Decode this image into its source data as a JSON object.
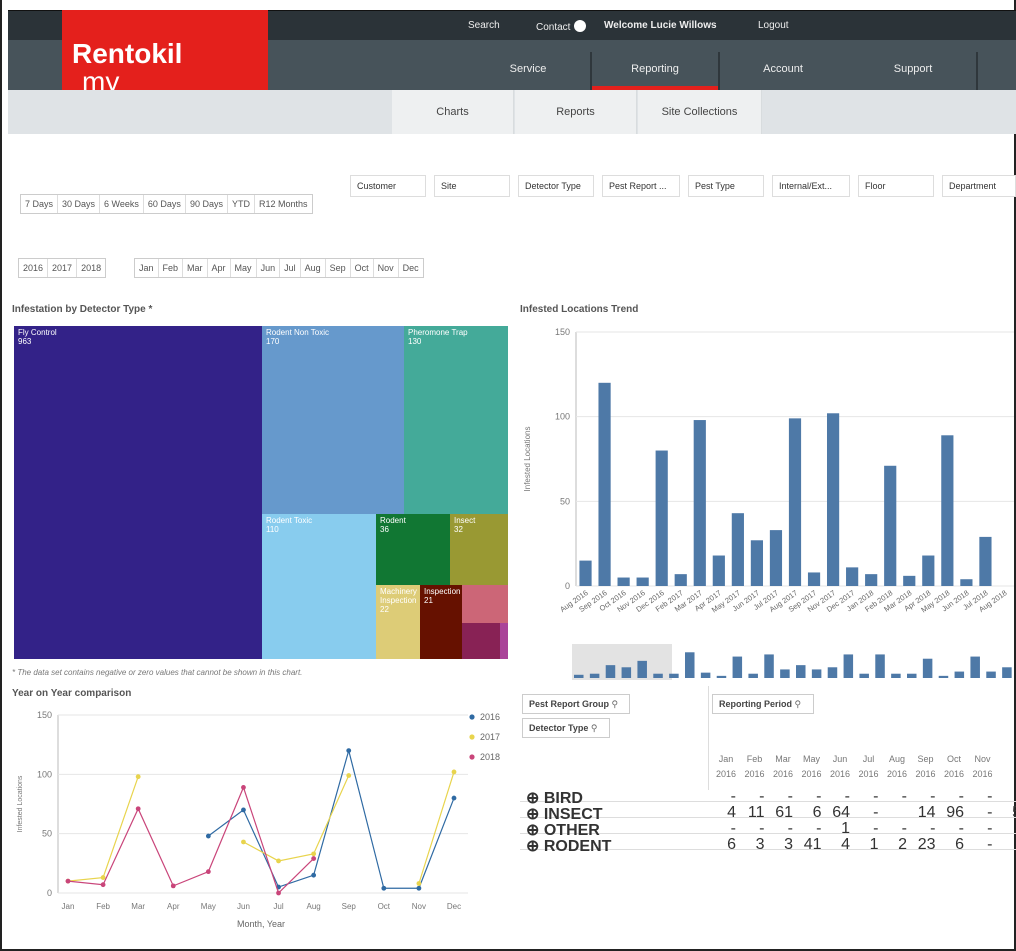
{
  "top_links": {
    "search": "Search",
    "contact": "Contact",
    "welcome": "Welcome Lucie Willows",
    "logout": "Logout"
  },
  "logo": {
    "my": "my",
    "brand": "Rentokil"
  },
  "nav": [
    "Service",
    "Reporting",
    "Account",
    "Support"
  ],
  "subnav": [
    "Charts",
    "Reports",
    "Site Collections"
  ],
  "period_buttons": [
    "7 Days",
    "30 Days",
    "6 Weeks",
    "60 Days",
    "90 Days",
    "YTD",
    "R12 Months"
  ],
  "filters": [
    "Customer",
    "Site",
    "Detector Type",
    "Pest Report ...",
    "Pest Type",
    "Internal/Ext...",
    "Floor",
    "Department"
  ],
  "year_buttons": [
    "2016",
    "2017",
    "2018"
  ],
  "month_buttons": [
    "Jan",
    "Feb",
    "Mar",
    "Apr",
    "May",
    "Jun",
    "Jul",
    "Aug",
    "Sep",
    "Oct",
    "Nov",
    "Dec"
  ],
  "treemap": {
    "title": "Infestation by Detector Type *",
    "footnote": "* The data set contains negative or zero values that cannot be shown in this chart.",
    "cells": [
      {
        "label": "Fly Control",
        "value": "963",
        "color": "#332288"
      },
      {
        "label": "Rodent Non Toxic",
        "value": "170",
        "color": "#6699cc"
      },
      {
        "label": "Pheromone Trap",
        "value": "130",
        "color": "#44aa99"
      },
      {
        "label": "Rodent Toxic",
        "value": "110",
        "color": "#88ccee"
      },
      {
        "label": "Rodent",
        "value": "36",
        "color": "#117733"
      },
      {
        "label": "Insect",
        "value": "32",
        "color": "#999933"
      },
      {
        "label": "Machinery Inspection",
        "value": "22",
        "color": "#ddcc77"
      },
      {
        "label": "Inspection",
        "value": "21",
        "color": "#661100"
      },
      {
        "label": "",
        "value": "",
        "color": "#cc6677"
      },
      {
        "label": "",
        "value": "",
        "color": "#882255"
      },
      {
        "label": "",
        "value": "",
        "color": "#aa4499"
      }
    ]
  },
  "chart_data": [
    {
      "type": "bar",
      "title": "Infested Locations Trend",
      "ylabel": "Infested Locations",
      "ylim": [
        0,
        150
      ],
      "yticks": [
        0,
        50,
        100,
        150
      ],
      "color": "#4e79a7",
      "categories": [
        "Aug 2016",
        "Sep 2016",
        "Oct 2016",
        "Nov 2016",
        "Dec 2016",
        "Feb 2017",
        "Mar 2017",
        "Apr 2017",
        "May 2017",
        "Jun 2017",
        "Jul 2017",
        "Aug 2017",
        "Sep 2017",
        "Nov 2017",
        "Dec 2017",
        "Jan 2018",
        "Feb 2018",
        "Mar 2018",
        "Apr 2018",
        "May 2018",
        "Jun 2018",
        "Jul 2018",
        "Aug 2018"
      ],
      "values": [
        15,
        120,
        5,
        5,
        80,
        7,
        98,
        18,
        43,
        27,
        33,
        99,
        8,
        102,
        11,
        7,
        71,
        6,
        18,
        89,
        4,
        29,
        0
      ],
      "scrollbar": [
        3,
        4,
        12,
        10,
        16,
        4,
        4,
        24,
        5,
        2,
        20,
        4,
        22,
        8,
        12,
        8,
        10,
        22,
        4,
        22,
        4,
        4,
        18,
        2,
        6,
        20,
        6,
        10
      ]
    },
    {
      "type": "line",
      "title": "Year on Year comparison",
      "xlabel": "Month, Year",
      "ylabel": "Infested Locations",
      "ylim": [
        0,
        150
      ],
      "yticks": [
        0,
        50,
        100,
        150
      ],
      "categories": [
        "Jan",
        "Feb",
        "Mar",
        "Apr",
        "May",
        "Jun",
        "Jul",
        "Aug",
        "Sep",
        "Oct",
        "Nov",
        "Dec"
      ],
      "legend_position": "top-right",
      "series": [
        {
          "name": "2016",
          "color": "#2f6aa3",
          "values": [
            null,
            null,
            null,
            null,
            48,
            70,
            5,
            15,
            120,
            4,
            4,
            80
          ]
        },
        {
          "name": "2017",
          "color": "#e8d44d",
          "values": [
            10,
            13,
            98,
            null,
            null,
            43,
            27,
            33,
            99,
            null,
            8,
            102
          ]
        },
        {
          "name": "2018",
          "color": "#c9457a",
          "values": [
            10,
            7,
            71,
            6,
            18,
            89,
            0,
            29,
            null,
            null,
            null,
            null
          ]
        }
      ]
    }
  ],
  "pivot": {
    "dim_pest_group": "Pest Report Group",
    "dim_period": "Reporting Period",
    "dim_detector": "Detector Type",
    "columns": [
      {
        "month": "Jan",
        "year": "2016"
      },
      {
        "month": "Feb",
        "year": "2016"
      },
      {
        "month": "Mar",
        "year": "2016"
      },
      {
        "month": "May",
        "year": "2016"
      },
      {
        "month": "Jun",
        "year": "2016"
      },
      {
        "month": "Jul",
        "year": "2016"
      },
      {
        "month": "Aug",
        "year": "2016"
      },
      {
        "month": "Sep",
        "year": "2016"
      },
      {
        "month": "Oct",
        "year": "2016"
      },
      {
        "month": "Nov",
        "year": "2016"
      }
    ],
    "rows": [
      {
        "label": "BIRD",
        "cells": [
          "-",
          "-",
          "-",
          "-",
          "-",
          "-",
          "-",
          "-",
          "-",
          "-"
        ]
      },
      {
        "label": "INSECT",
        "cells": [
          "4",
          "11",
          "61",
          "6",
          "64",
          "-",
          "",
          "14",
          "96",
          "-",
          "5"
        ]
      },
      {
        "label": "OTHER",
        "cells": [
          "-",
          "-",
          "-",
          "-",
          "1",
          "-",
          "-",
          "-",
          "-",
          "-"
        ]
      },
      {
        "label": "RODENT",
        "cells": [
          "6",
          "3",
          "3",
          "41",
          "4",
          "1",
          "2",
          "23",
          "6",
          "-"
        ]
      }
    ]
  }
}
